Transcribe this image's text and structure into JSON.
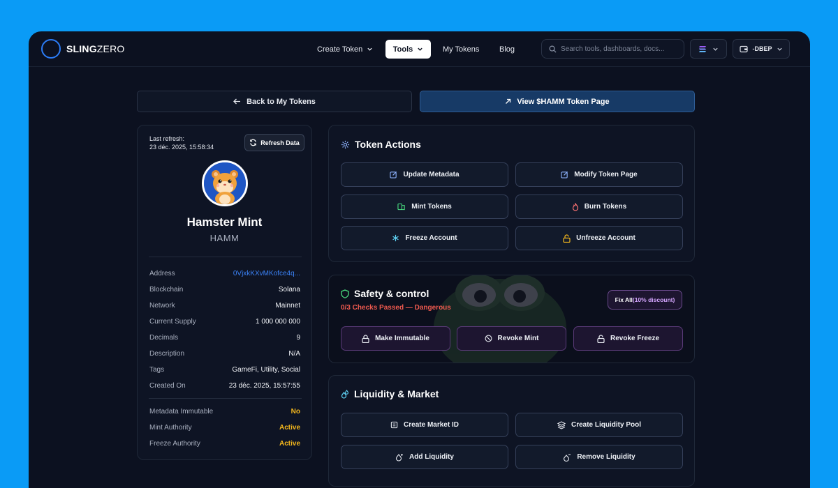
{
  "nav": {
    "brand_bold": "SLING",
    "brand_light": "ZERO",
    "items": [
      {
        "label": "Create Token",
        "dropdown": true
      },
      {
        "label": "Tools",
        "dropdown": true,
        "active": true
      },
      {
        "label": "My Tokens",
        "dropdown": false
      },
      {
        "label": "Blog",
        "dropdown": false
      }
    ],
    "search_placeholder": "Search tools, dashboards, docs...",
    "wallet_label": "-DBEP"
  },
  "top_buttons": {
    "back": "Back to My Tokens",
    "view": "View $HAMM Token Page"
  },
  "token": {
    "refresh_label": "Last refresh:",
    "refresh_time": "23 déc. 2025, 15:58:34",
    "refresh_button": "Refresh Data",
    "name": "Hamster Mint",
    "symbol": "HAMM",
    "details": [
      {
        "key": "Address",
        "value": "0VjxkKXvMKofce4q..."
      },
      {
        "key": "Blockchain",
        "value": "Solana"
      },
      {
        "key": "Network",
        "value": "Mainnet"
      },
      {
        "key": "Current Supply",
        "value": "1 000 000 000"
      },
      {
        "key": "Decimals",
        "value": "9"
      },
      {
        "key": "Description",
        "value": "N/A"
      },
      {
        "key": "Tags",
        "value": "GameFi, Utility, Social"
      },
      {
        "key": "Created On",
        "value": "23 déc. 2025, 15:57:55"
      }
    ],
    "authorities": [
      {
        "key": "Metadata Immutable",
        "value": "No"
      },
      {
        "key": "Mint Authority",
        "value": "Active"
      },
      {
        "key": "Freeze Authority",
        "value": "Active"
      }
    ]
  },
  "token_actions": {
    "title": "Token Actions",
    "buttons": [
      "Update Metadata",
      "Modify Token Page",
      "Mint Tokens",
      "Burn Tokens",
      "Freeze Account",
      "Unfreeze Account"
    ]
  },
  "safety": {
    "title": "Safety & control",
    "status": "0/3 Checks Passed — Dangerous",
    "fix_label": "Fix All",
    "fix_discount": "(10% discount)",
    "buttons": [
      "Make Immutable",
      "Revoke Mint",
      "Revoke Freeze"
    ]
  },
  "liquidity": {
    "title": "Liquidity & Market",
    "buttons": [
      "Create Market ID",
      "Create Liquidity Pool",
      "Add Liquidity",
      "Remove Liquidity"
    ]
  },
  "colors": {
    "accent_blue": "#2b7cf6",
    "warning_yellow": "#f5b81d",
    "danger_red": "#ef5a4f",
    "link_blue": "#3b82f6"
  }
}
